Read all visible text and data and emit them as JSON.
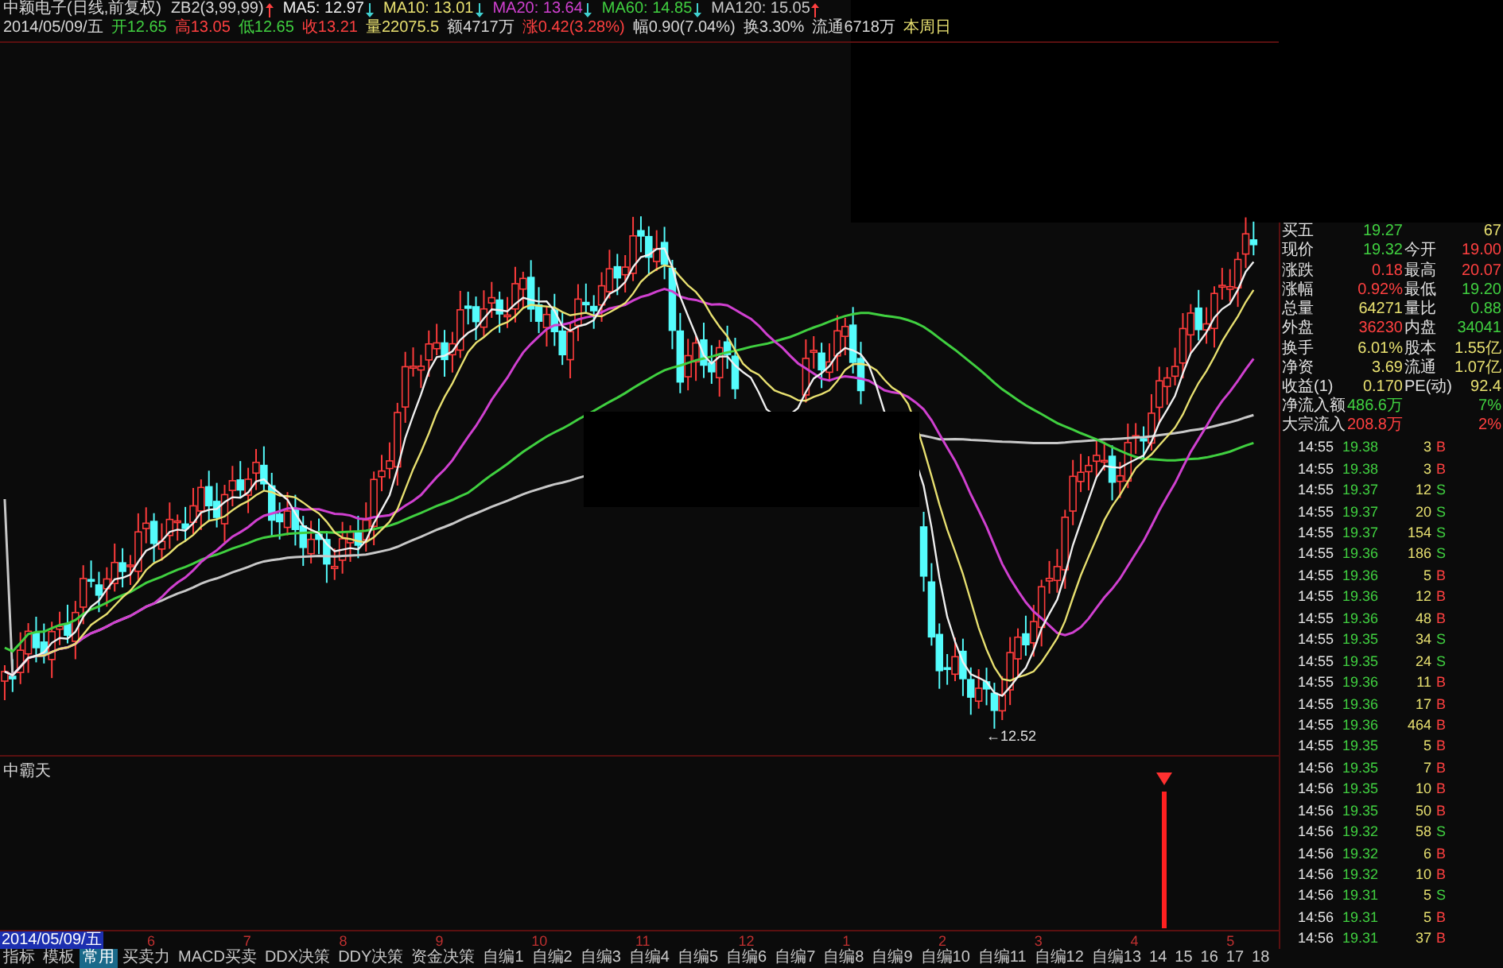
{
  "header": {
    "line1": [
      {
        "text": "中颖电子(日线,前复权)",
        "color": "#d8d8d8",
        "kind": "plain"
      },
      {
        "text": "ZB2(3,99,99)",
        "color": "#d8d8d8",
        "kind": "rising"
      },
      {
        "text": "MA5: 12.97",
        "color": "#f0f0f0",
        "kind": "falling"
      },
      {
        "text": "MA10: 13.01",
        "color": "#e8e070",
        "kind": "falling"
      },
      {
        "text": "MA20: 13.64",
        "color": "#d040d0",
        "kind": "falling"
      },
      {
        "text": "MA60: 14.85",
        "color": "#40d040",
        "kind": "falling"
      },
      {
        "text": "MA120: 15.05",
        "color": "#c8c8c8",
        "kind": "rising"
      }
    ],
    "line2": [
      {
        "text": "2014/05/09/五",
        "color": "#d8d8d8"
      },
      {
        "text": "开12.65",
        "color": "#40d040"
      },
      {
        "text": "高13.05",
        "color": "#ff4040"
      },
      {
        "text": "低12.65",
        "color": "#40d040"
      },
      {
        "text": "收13.21",
        "color": "#ff4040"
      },
      {
        "text": "量22075.5",
        "color": "#e8e070"
      },
      {
        "text": "额4717万",
        "color": "#d8d8d8"
      },
      {
        "text": "涨0.42(3.28%)",
        "color": "#ff4040"
      },
      {
        "text": "幅0.90(7.04%)",
        "color": "#d8d8d8"
      },
      {
        "text": "换3.30%",
        "color": "#d8d8d8"
      },
      {
        "text": "流通6718万",
        "color": "#d8d8d8"
      },
      {
        "text": "本周日",
        "color": "#e8e070"
      }
    ]
  },
  "main_chart": {
    "low_label": "←12.52"
  },
  "indicator": {
    "title": "中霸天"
  },
  "x_axis": {
    "date_badge": "2014/05/09/五",
    "labels": [
      "6",
      "7",
      "8",
      "9",
      "10",
      "11",
      "12",
      "1",
      "2",
      "3",
      "4",
      "5"
    ]
  },
  "quote": [
    {
      "label": "买五",
      "value": {
        "text": "19.27",
        "color": "#40d040"
      },
      "value2": {
        "text": "67",
        "color": "#e8e070"
      }
    },
    {
      "label": "现价",
      "value": {
        "text": "19.32",
        "color": "#40d040"
      },
      "label2": "今开",
      "value2": {
        "text": "19.00",
        "color": "#ff4040"
      }
    },
    {
      "label": "涨跌",
      "value": {
        "text": "0.18",
        "color": "#ff4040"
      },
      "label2": "最高",
      "value2": {
        "text": "20.07",
        "color": "#ff4040"
      }
    },
    {
      "label": "涨幅",
      "value": {
        "text": "0.92%",
        "color": "#ff4040"
      },
      "label2": "最低",
      "value2": {
        "text": "19.20",
        "color": "#40d040"
      }
    },
    {
      "label": "总量",
      "value": {
        "text": "64271",
        "color": "#e8e070"
      },
      "label2": "量比",
      "value2": {
        "text": "0.88",
        "color": "#40d040"
      }
    },
    {
      "label": "外盘",
      "value": {
        "text": "36230",
        "color": "#ff4040"
      },
      "label2": "内盘",
      "value2": {
        "text": "34041",
        "color": "#40d040"
      }
    },
    {
      "label": "换手",
      "value": {
        "text": "6.01%",
        "color": "#e8e070"
      },
      "label2": "股本",
      "value2": {
        "text": "1.55亿",
        "color": "#e8e070"
      }
    },
    {
      "label": "净资",
      "value": {
        "text": "3.69",
        "color": "#e8e070"
      },
      "label2": "流通",
      "value2": {
        "text": "1.07亿",
        "color": "#e8e070"
      }
    },
    {
      "label": "收益(1)",
      "value": {
        "text": "0.170",
        "color": "#e8e070"
      },
      "label2": "PE(动)",
      "value2": {
        "text": "92.4",
        "color": "#e8e070"
      }
    },
    {
      "label": "净流入额",
      "value": {
        "text": "486.6万",
        "color": "#40d040"
      },
      "value2": {
        "text": "7%",
        "color": "#40d040"
      }
    },
    {
      "label": "大宗流入",
      "value": {
        "text": "208.8万",
        "color": "#ff4040"
      },
      "value2": {
        "text": "2%",
        "color": "#ff4040"
      }
    }
  ],
  "ticks": [
    {
      "time": "14:55",
      "price": "19.38",
      "volume": "3",
      "side": "B",
      "kind": "buy"
    },
    {
      "time": "14:55",
      "price": "19.38",
      "volume": "3",
      "side": "B",
      "kind": "buy"
    },
    {
      "time": "14:55",
      "price": "19.37",
      "volume": "12",
      "side": "S",
      "kind": "sell"
    },
    {
      "time": "14:55",
      "price": "19.37",
      "volume": "20",
      "side": "S",
      "kind": "sell"
    },
    {
      "time": "14:55",
      "price": "19.37",
      "volume": "154",
      "side": "S",
      "kind": "sell"
    },
    {
      "time": "14:55",
      "price": "19.36",
      "volume": "186",
      "side": "S",
      "kind": "sell"
    },
    {
      "time": "14:55",
      "price": "19.36",
      "volume": "5",
      "side": "B",
      "kind": "buy"
    },
    {
      "time": "14:55",
      "price": "19.36",
      "volume": "12",
      "side": "B",
      "kind": "buy"
    },
    {
      "time": "14:55",
      "price": "19.36",
      "volume": "48",
      "side": "B",
      "kind": "buy"
    },
    {
      "time": "14:55",
      "price": "19.35",
      "volume": "34",
      "side": "S",
      "kind": "sell"
    },
    {
      "time": "14:55",
      "price": "19.35",
      "volume": "24",
      "side": "S",
      "kind": "sell"
    },
    {
      "time": "14:55",
      "price": "19.36",
      "volume": "11",
      "side": "B",
      "kind": "buy"
    },
    {
      "time": "14:55",
      "price": "19.36",
      "volume": "17",
      "side": "B",
      "kind": "buy"
    },
    {
      "time": "14:55",
      "price": "19.36",
      "volume": "464",
      "side": "B",
      "kind": "buy"
    },
    {
      "time": "14:55",
      "price": "19.35",
      "volume": "5",
      "side": "B",
      "kind": "buy"
    },
    {
      "time": "14:56",
      "price": "19.35",
      "volume": "7",
      "side": "B",
      "kind": "buy"
    },
    {
      "time": "14:56",
      "price": "19.35",
      "volume": "10",
      "side": "B",
      "kind": "buy"
    },
    {
      "time": "14:56",
      "price": "19.35",
      "volume": "50",
      "side": "B",
      "kind": "buy"
    },
    {
      "time": "14:56",
      "price": "19.32",
      "volume": "58",
      "side": "S",
      "kind": "sell"
    },
    {
      "time": "14:56",
      "price": "19.32",
      "volume": "6",
      "side": "B",
      "kind": "buy"
    },
    {
      "time": "14:56",
      "price": "19.32",
      "volume": "10",
      "side": "B",
      "kind": "buy"
    },
    {
      "time": "14:56",
      "price": "19.31",
      "volume": "5",
      "side": "S",
      "kind": "sell"
    },
    {
      "time": "14:56",
      "price": "19.31",
      "volume": "5",
      "side": "B",
      "kind": "buy"
    },
    {
      "time": "14:56",
      "price": "19.31",
      "volume": "37",
      "side": "B",
      "kind": "buy"
    }
  ],
  "tabs": [
    {
      "label": "指标",
      "selected": false
    },
    {
      "label": "模板",
      "selected": false
    },
    {
      "label": "常用",
      "selected": true
    },
    {
      "label": "买卖力",
      "selected": false
    },
    {
      "label": "MACD买卖",
      "selected": false
    },
    {
      "label": "DDX决策",
      "selected": false
    },
    {
      "label": "DDY决策",
      "selected": false
    },
    {
      "label": "资金决策",
      "selected": false
    },
    {
      "label": "自编1",
      "selected": false
    },
    {
      "label": "自编2",
      "selected": false
    },
    {
      "label": "自编3",
      "selected": false
    },
    {
      "label": "自编4",
      "selected": false
    },
    {
      "label": "自编5",
      "selected": false
    },
    {
      "label": "自编6",
      "selected": false
    },
    {
      "label": "自编7",
      "selected": false
    },
    {
      "label": "自编8",
      "selected": false
    },
    {
      "label": "自编9",
      "selected": false
    },
    {
      "label": "自编10",
      "selected": false
    },
    {
      "label": "自编11",
      "selected": false
    },
    {
      "label": "自编12",
      "selected": false
    },
    {
      "label": "自编13",
      "selected": false
    },
    {
      "label": "14",
      "selected": false
    },
    {
      "label": "15",
      "selected": false
    },
    {
      "label": "16",
      "selected": false
    },
    {
      "label": "17",
      "selected": false
    },
    {
      "label": "18",
      "selected": false
    }
  ]
}
